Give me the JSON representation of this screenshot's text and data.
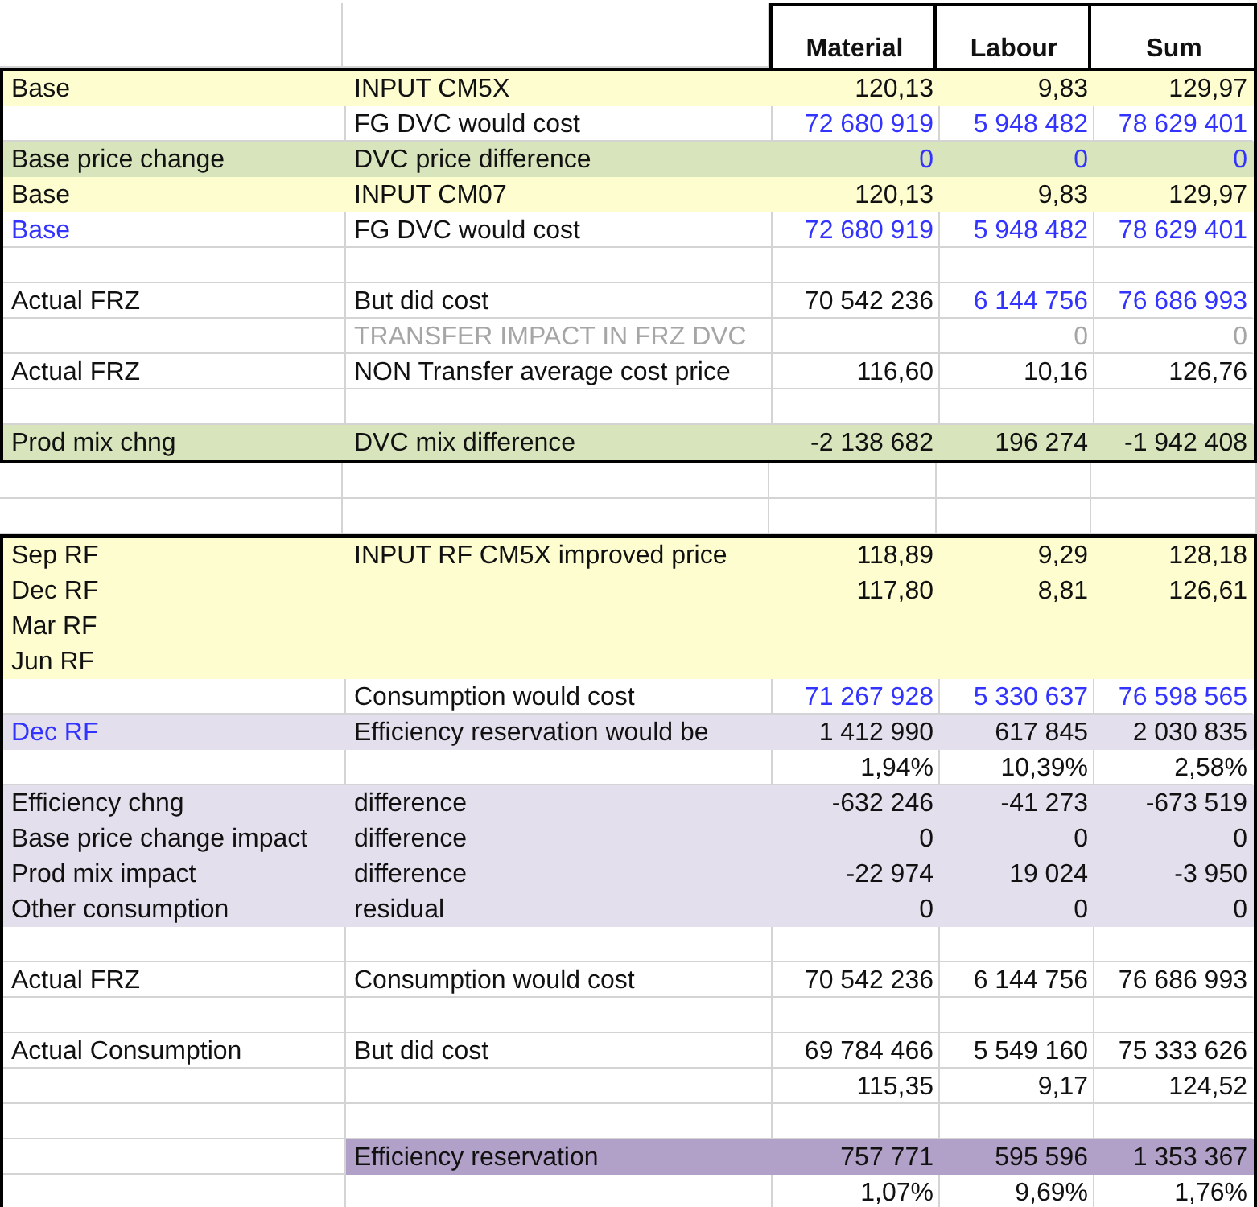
{
  "columns": [
    "Material",
    "Labour",
    "Sum"
  ],
  "sections": [
    {
      "rows": [
        {
          "kind": "yellow",
          "cells": [
            {
              "text": "Base"
            },
            {
              "text": "INPUT CM5X"
            },
            {
              "text": "120,13"
            },
            {
              "text": "9,83"
            },
            {
              "text": "129,97"
            }
          ]
        },
        {
          "kind": "plain",
          "cells": [
            null,
            {
              "text": "FG DVC would cost"
            },
            {
              "text": "72 680 919",
              "kind": "link"
            },
            {
              "text": "5 948 482",
              "kind": "link"
            },
            {
              "text": "78 629 401",
              "kind": "link"
            }
          ]
        },
        {
          "kind": "green",
          "cells": [
            {
              "text": "Base price change"
            },
            {
              "text": "DVC price difference"
            },
            {
              "text": "0",
              "kind": "link"
            },
            {
              "text": "0",
              "kind": "link"
            },
            {
              "text": "0",
              "kind": "link"
            }
          ]
        },
        {
          "kind": "yellow",
          "cells": [
            {
              "text": "Base"
            },
            {
              "text": "INPUT CM07"
            },
            {
              "text": "120,13"
            },
            {
              "text": "9,83"
            },
            {
              "text": "129,97"
            }
          ]
        },
        {
          "kind": "plain",
          "cells": [
            {
              "text": "Base",
              "kind": "link"
            },
            {
              "text": "FG DVC would cost"
            },
            {
              "text": "72 680 919",
              "kind": "link"
            },
            {
              "text": "5 948 482",
              "kind": "link"
            },
            {
              "text": "78 629 401",
              "kind": "link"
            }
          ]
        },
        {
          "kind": "blank"
        },
        {
          "kind": "plain",
          "cells": [
            {
              "text": "Actual FRZ"
            },
            {
              "text": "But did cost"
            },
            {
              "text": "70 542 236"
            },
            {
              "text": "6 144 756",
              "kind": "link"
            },
            {
              "text": "76 686 993",
              "kind": "link"
            }
          ]
        },
        {
          "kind": "plain",
          "cells": [
            null,
            {
              "text": "TRANSFER IMPACT IN FRZ DVC",
              "kind": "muted"
            },
            null,
            {
              "text": "0",
              "kind": "muted"
            },
            {
              "text": "0",
              "kind": "muted"
            }
          ]
        },
        {
          "kind": "plain",
          "cells": [
            {
              "text": "Actual FRZ"
            },
            {
              "text": "NON Transfer average cost price"
            },
            {
              "text": "116,60"
            },
            {
              "text": "10,16"
            },
            {
              "text": "126,76"
            }
          ]
        },
        {
          "kind": "blank"
        },
        {
          "kind": "green",
          "cells": [
            {
              "text": "Prod mix chng"
            },
            {
              "text": "DVC mix difference"
            },
            {
              "text": "-2 138 682"
            },
            {
              "text": "196 274"
            },
            {
              "text": "-1 942 408"
            }
          ]
        }
      ]
    },
    {
      "rows": [
        {
          "kind": "yellow",
          "cells": [
            {
              "text": "Sep RF"
            },
            {
              "text": "INPUT RF CM5X improved price"
            },
            {
              "text": "118,89"
            },
            {
              "text": "9,29"
            },
            {
              "text": "128,18"
            }
          ]
        },
        {
          "kind": "yellow",
          "cells": [
            {
              "text": "Dec RF"
            },
            null,
            {
              "text": "117,80"
            },
            {
              "text": "8,81"
            },
            {
              "text": "126,61"
            }
          ]
        },
        {
          "kind": "yellow",
          "cells": [
            {
              "text": "Mar RF"
            }
          ]
        },
        {
          "kind": "yellow",
          "cells": [
            {
              "text": "Jun RF"
            }
          ]
        },
        {
          "kind": "plain",
          "cells": [
            null,
            {
              "text": "Consumption would cost"
            },
            {
              "text": "71 267 928",
              "kind": "link"
            },
            {
              "text": "5 330 637",
              "kind": "link"
            },
            {
              "text": "76 598 565",
              "kind": "link"
            }
          ]
        },
        {
          "kind": "lilac",
          "cells": [
            {
              "text": "Dec RF",
              "kind": "link"
            },
            {
              "text": "Efficiency reservation would be"
            },
            {
              "text": "1 412 990"
            },
            {
              "text": "617 845"
            },
            {
              "text": "2 030 835"
            }
          ]
        },
        {
          "kind": "plain",
          "cells": [
            null,
            null,
            {
              "text": "1,94%"
            },
            {
              "text": "10,39%"
            },
            {
              "text": "2,58%"
            }
          ]
        },
        {
          "kind": "lilac",
          "cells": [
            {
              "text": "Efficiency chng"
            },
            {
              "text": "difference"
            },
            {
              "text": "-632 246"
            },
            {
              "text": "-41 273"
            },
            {
              "text": "-673 519"
            }
          ]
        },
        {
          "kind": "lilac",
          "cells": [
            {
              "text": "Base price change impact"
            },
            {
              "text": "difference"
            },
            {
              "text": "0"
            },
            {
              "text": "0"
            },
            {
              "text": "0"
            }
          ]
        },
        {
          "kind": "lilac",
          "cells": [
            {
              "text": "Prod mix impact"
            },
            {
              "text": "difference"
            },
            {
              "text": "-22 974"
            },
            {
              "text": "19 024"
            },
            {
              "text": "-3 950"
            }
          ]
        },
        {
          "kind": "lilac",
          "cells": [
            {
              "text": "Other consumption"
            },
            {
              "text": "residual"
            },
            {
              "text": "0"
            },
            {
              "text": "0"
            },
            {
              "text": "0"
            }
          ]
        },
        {
          "kind": "blank"
        },
        {
          "kind": "plain",
          "cells": [
            {
              "text": "Actual FRZ"
            },
            {
              "text": "Consumption would cost"
            },
            {
              "text": "70 542 236"
            },
            {
              "text": "6 144 756"
            },
            {
              "text": "76 686 993"
            }
          ]
        },
        {
          "kind": "blank"
        },
        {
          "kind": "plain",
          "cells": [
            {
              "text": "Actual Consumption"
            },
            {
              "text": "But did cost"
            },
            {
              "text": "69 784 466"
            },
            {
              "text": "5 549 160"
            },
            {
              "text": "75 333 626"
            }
          ]
        },
        {
          "kind": "plain",
          "cells": [
            null,
            null,
            {
              "text": "115,35"
            },
            {
              "text": "9,17"
            },
            {
              "text": "124,52"
            }
          ]
        },
        {
          "kind": "blank"
        },
        {
          "kind": "purple",
          "cells": [
            null,
            {
              "text": "Efficiency reservation"
            },
            {
              "text": "757 771"
            },
            {
              "text": "595 596"
            },
            {
              "text": "1 353 367"
            }
          ]
        },
        {
          "kind": "plain",
          "cells": [
            null,
            null,
            {
              "text": "1,07%"
            },
            {
              "text": "9,69%"
            },
            {
              "text": "1,76%"
            }
          ]
        }
      ]
    }
  ]
}
